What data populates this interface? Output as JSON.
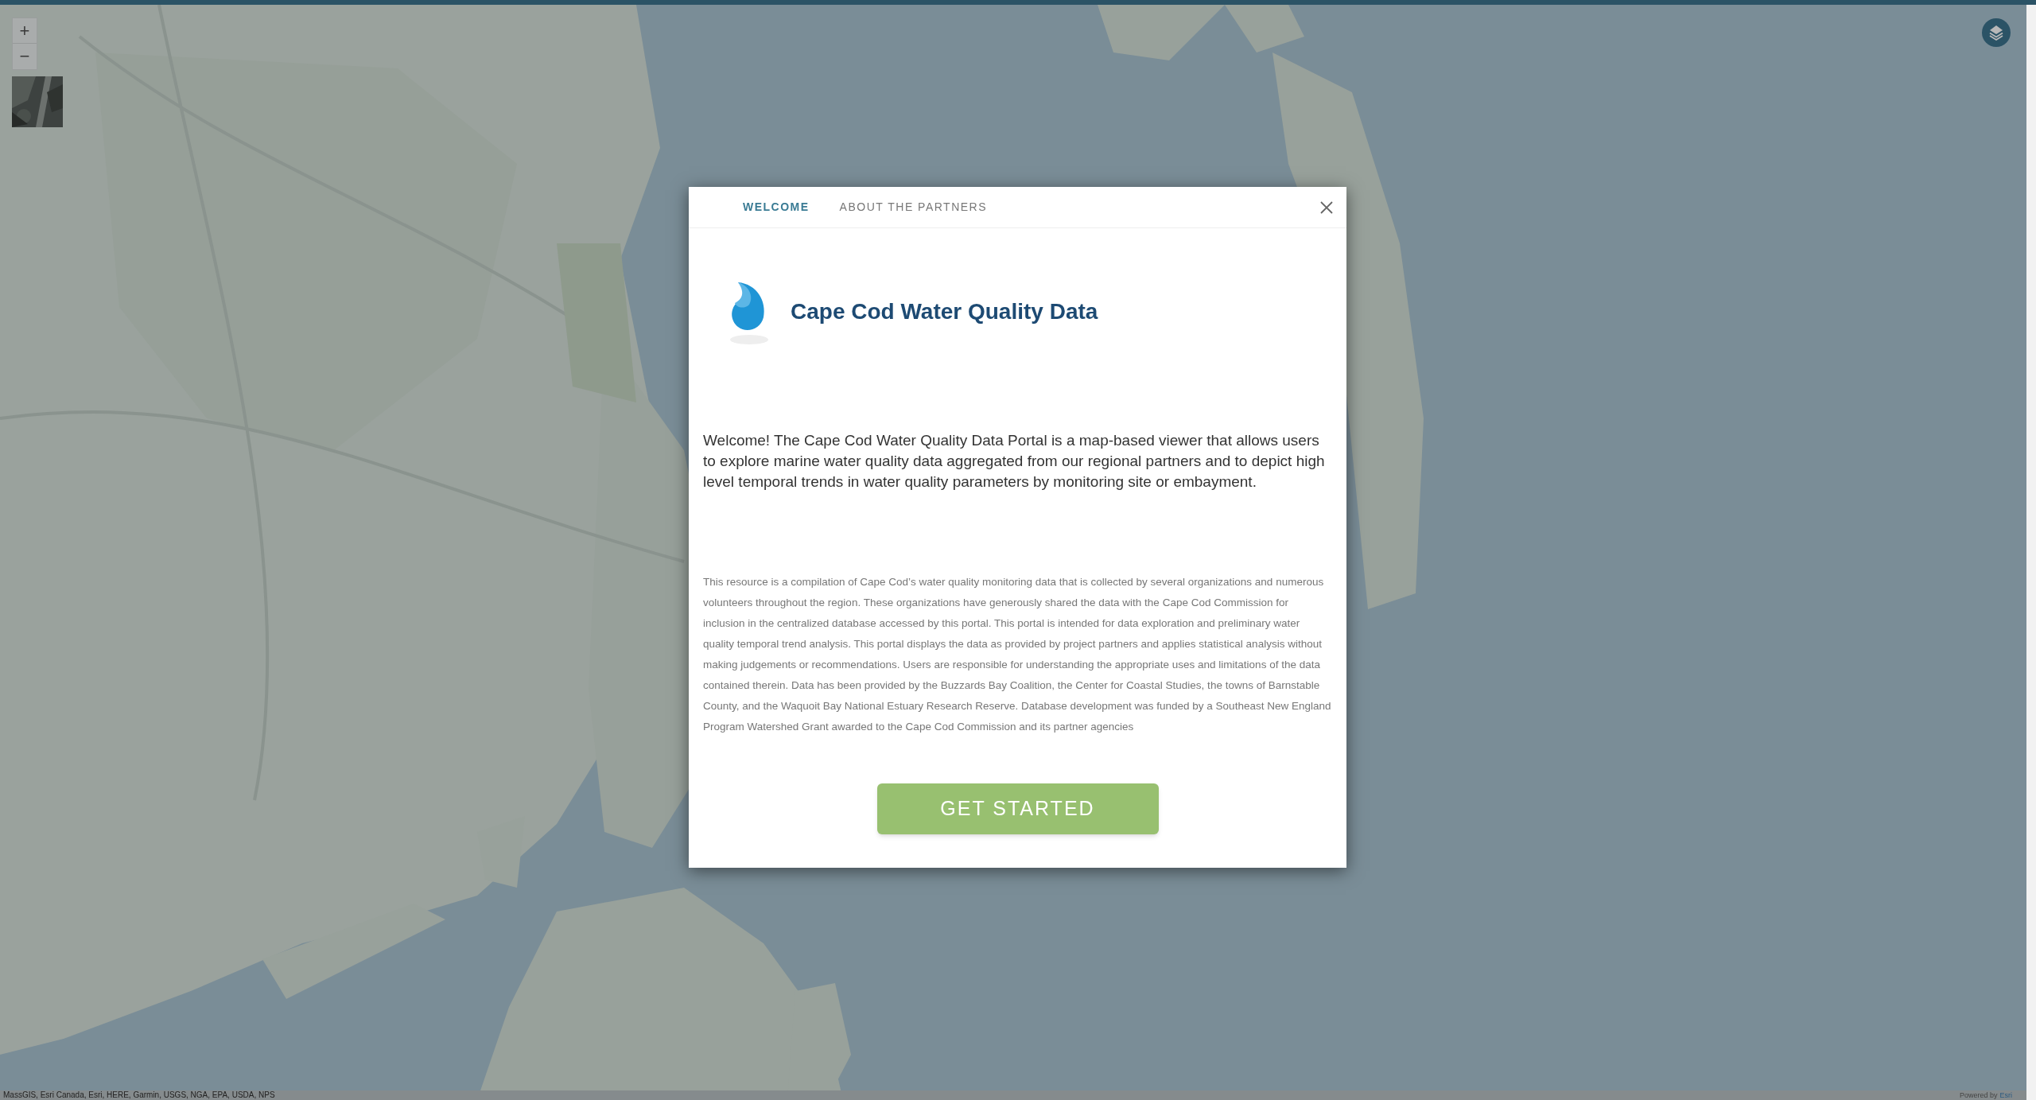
{
  "map": {
    "zoom_controls": [
      "+",
      "−"
    ],
    "attribution": "MassGIS, Esri Canada, Esri, HERE, Garmin, USGS, NGA, EPA, USDA, NPS",
    "powered_by": "Powered by",
    "powered_by_link": "Esri"
  },
  "dialog": {
    "tabs": [
      {
        "label": "WELCOME",
        "selected": true
      },
      {
        "label": "ABOUT THE PARTNERS",
        "selected": false
      }
    ],
    "title": "Cape Cod Water Quality Data",
    "intro": "Welcome! The Cape Cod Water Quality Data Portal is a map-based viewer that allows users to explore marine water quality data aggregated from our regional partners and to depict high level temporal trends in water quality parameters by monitoring site or embayment.",
    "disclaimer": "This resource is a compilation of Cape Cod’s water quality monitoring data that is collected by several organizations and numerous volunteers throughout the region. These organizations have generously shared the data with the Cape Cod Commission for inclusion in the centralized database accessed by this portal. This portal is intended for data exploration and preliminary water quality temporal trend analysis. This portal displays the data as provided by project partners and applies statistical analysis without making judgements or recommendations. Users are responsible for understanding the appropriate uses and limitations of the data contained therein. Data has been provided by the Buzzards Bay Coalition, the Center for Coastal Studies, the towns of Barnstable County, and the Waquoit Bay National Estuary Research Reserve. Database development was funded by a Southeast New England Program Watershed Grant awarded to the Cape Cod Commission and its partner agencies",
    "button": "GET STARTED"
  }
}
